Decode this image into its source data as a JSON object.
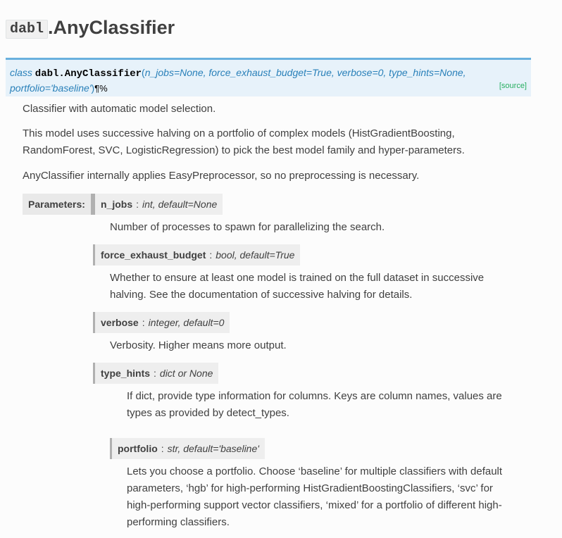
{
  "title": {
    "module": "dabl",
    "name": ".AnyClassifier"
  },
  "signature": {
    "keyword": "class",
    "classname": "dabl.AnyClassifier",
    "open_paren": "(",
    "params_line1": "n_jobs=None, force_exhaust_budget=True, verbose=0, type_hints=None,",
    "params_line2": "portfolio='baseline'",
    "close_paren": ")",
    "pilcrow": "¶",
    "link_icon": "%",
    "source_link": "[source]"
  },
  "description": {
    "summary": "Classifier with automatic model selection.",
    "para1_line1": "This model uses successive halving on a portfolio of complex models (HistGradientBoosting,",
    "para1_line2": "RandomForest, SVC, LogisticRegression) to pick the best model family and hyper-parameters.",
    "para2": "AnyClassifier internally applies EasyPreprocessor, so no preprocessing is necessary."
  },
  "parameters_label": "Parameters:",
  "parameters": [
    {
      "name": "n_jobs",
      "colon": ":",
      "type": "int, default=None",
      "desc": [
        "Number of processes to spawn for parallelizing the search."
      ]
    },
    {
      "name": "force_exhaust_budget",
      "colon": ":",
      "type": "bool, default=True",
      "desc": [
        "Whether to ensure at least one model is trained on the full dataset in successive",
        "halving. See the documentation of successive halving for details."
      ]
    },
    {
      "name": "verbose",
      "colon": ":",
      "type": "integer, default=0",
      "desc": [
        "Verbosity. Higher means more output."
      ]
    },
    {
      "name": "type_hints",
      "colon": ":",
      "type": "dict or None",
      "desc": [
        "If dict, provide type information for columns. Keys are column names, values are",
        "types as provided by detect_types."
      ]
    },
    {
      "name": "portfolio",
      "colon": ":",
      "type": "str, default='baseline'",
      "desc": [
        "Lets you choose a portfolio. Choose ‘baseline’ for multiple classifiers with default",
        "parameters, ‘hgb’ for high-performing HistGradientBoostingClassifiers, ‘svc’ for",
        "high-performing support vector classifiers, ‘mixed’ for a portfolio of different high-",
        "performing classifiers."
      ]
    }
  ]
}
